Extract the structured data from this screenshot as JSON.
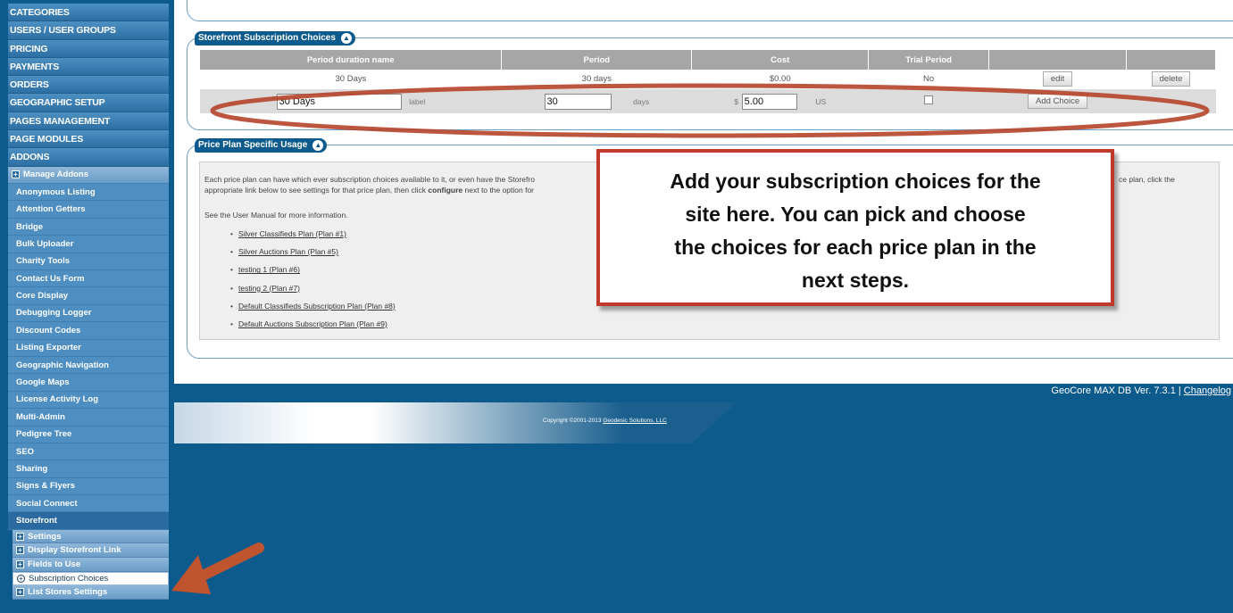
{
  "sidebar": {
    "top_items": [
      "CATEGORIES",
      "USERS / USER GROUPS",
      "PRICING",
      "PAYMENTS",
      "ORDERS",
      "GEOGRAPHIC SETUP",
      "PAGES MANAGEMENT",
      "PAGE MODULES",
      "ADDONS"
    ],
    "manage_addons": "Manage Addons",
    "addons": [
      "Anonymous Listing",
      "Attention Getters",
      "Bridge",
      "Bulk Uploader",
      "Charity Tools",
      "Contact Us Form",
      "Core Display",
      "Debugging Logger",
      "Discount Codes",
      "Listing Exporter",
      "Geographic Navigation",
      "Google Maps",
      "License Activity Log",
      "Multi-Admin",
      "Pedigree Tree",
      "SEO",
      "Sharing",
      "Signs & Flyers",
      "Social Connect",
      "Storefront"
    ],
    "storefront_items": [
      "Settings",
      "Display Storefront Link",
      "Fields to Use",
      "Subscription Choices",
      "List Stores Settings"
    ]
  },
  "storefront_choices": {
    "title": "Storefront Subscription Choices",
    "headers": [
      "Period duration name",
      "Period",
      "Cost",
      "Trial Period",
      "",
      ""
    ],
    "row": {
      "name": "30 Days",
      "period": "30 days",
      "cost": "$0.00",
      "trial": "No",
      "edit": "edit",
      "delete": "delete"
    },
    "new_row": {
      "name_value": "30 Days",
      "name_unit": "label",
      "period_value": "30",
      "period_unit": "days",
      "cost_prefix": "$",
      "cost_value": "5.00",
      "cost_unit": "US",
      "add_label": "Add Choice"
    }
  },
  "usage": {
    "title": "Price Plan Specific Usage",
    "para1_a": "Each price plan can have which ever subscription choices available to it, or even have the Storefro",
    "para1_b_pre": "appropriate link below to see settings for that price plan, then click ",
    "para1_b_bold": "configure",
    "para1_b_post": " next to the option for",
    "para1_right": "ce plan, click the",
    "para2": "See the User Manual for more information.",
    "plans": [
      "Silver Classifieds Plan (Plan #1)",
      "Silver Auctions Plan (Plan #5)",
      "testing 1 (Plan #6)",
      "testing 2 (Plan #7)",
      "Default Classifieds Subscription Plan (Plan #8)",
      "Default Auctions Subscription Plan (Plan #9)"
    ]
  },
  "annotation": {
    "lines": [
      "Add your subscription choices for the",
      "site here.  You can pick and choose",
      "the choices for each price plan in the",
      "next steps."
    ]
  },
  "footer": {
    "version": "GeoCore MAX DB Ver. 7.3.1 | ",
    "changelog": "Changelog",
    "copyright_pre": "Copyright ©2001-2013 ",
    "copyright_link": "Geodesic Solutions, LLC"
  },
  "colors": {
    "nav_blue": "#0d5a8c",
    "highlight_red": "#c0392b"
  }
}
